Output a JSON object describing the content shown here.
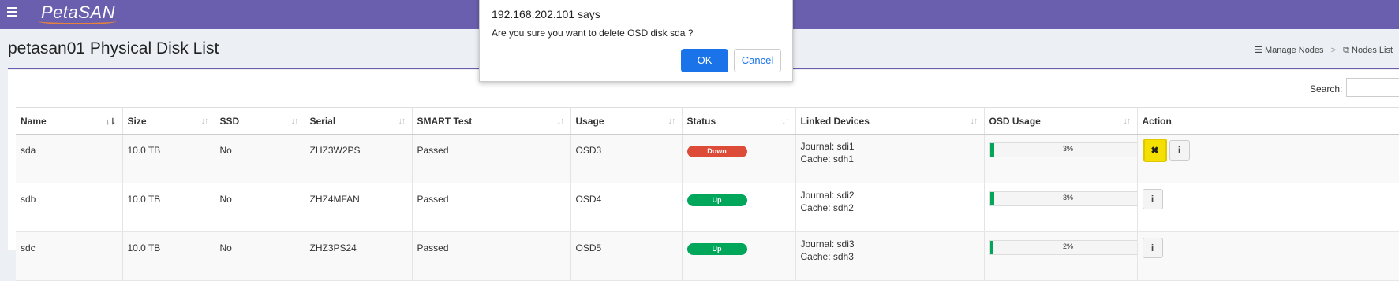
{
  "app": {
    "logo": "PetaSAN"
  },
  "page": {
    "title": "petasan01 Physical Disk List"
  },
  "breadcrumb": {
    "items": [
      "Manage Nodes",
      "Nodes List"
    ]
  },
  "search": {
    "label": "Search:",
    "value": ""
  },
  "table": {
    "columns": [
      "Name",
      "Size",
      "SSD",
      "Serial",
      "SMART Test",
      "Usage",
      "Status",
      "Linked Devices",
      "OSD Usage",
      "Action"
    ],
    "rows": [
      {
        "name": "sda",
        "size": "10.0 TB",
        "ssd": "No",
        "serial": "ZHZ3W2PS",
        "smart": "Passed",
        "usage": "OSD3",
        "status": "Down",
        "journal": "Journal: sdi1",
        "cache": "Cache: sdh1",
        "osd_usage_label": "3%",
        "osd_usage": 3
      },
      {
        "name": "sdb",
        "size": "10.0 TB",
        "ssd": "No",
        "serial": "ZHZ4MFAN",
        "smart": "Passed",
        "usage": "OSD4",
        "status": "Up",
        "journal": "Journal: sdi2",
        "cache": "Cache: sdh2",
        "osd_usage_label": "3%",
        "osd_usage": 3
      },
      {
        "name": "sdc",
        "size": "10.0 TB",
        "ssd": "No",
        "serial": "ZHZ3PS24",
        "smart": "Passed",
        "usage": "OSD5",
        "status": "Up",
        "journal": "Journal: sdi3",
        "cache": "Cache: sdh3",
        "osd_usage_label": "2%",
        "osd_usage": 2
      }
    ]
  },
  "dialog": {
    "title": "192.168.202.101 says",
    "message": "Are you sure you want to delete OSD disk sda ?",
    "ok_label": "OK",
    "cancel_label": "Cancel"
  },
  "icons": {
    "delete": "✖",
    "info": "i",
    "menu": "hamburger-icon",
    "sort": "⇅"
  },
  "colors": {
    "header": "#6a5fae",
    "down": "#dd4b39",
    "up": "#00a65a",
    "delete_button": "#f3e000",
    "ok_button": "#1a73e8"
  }
}
